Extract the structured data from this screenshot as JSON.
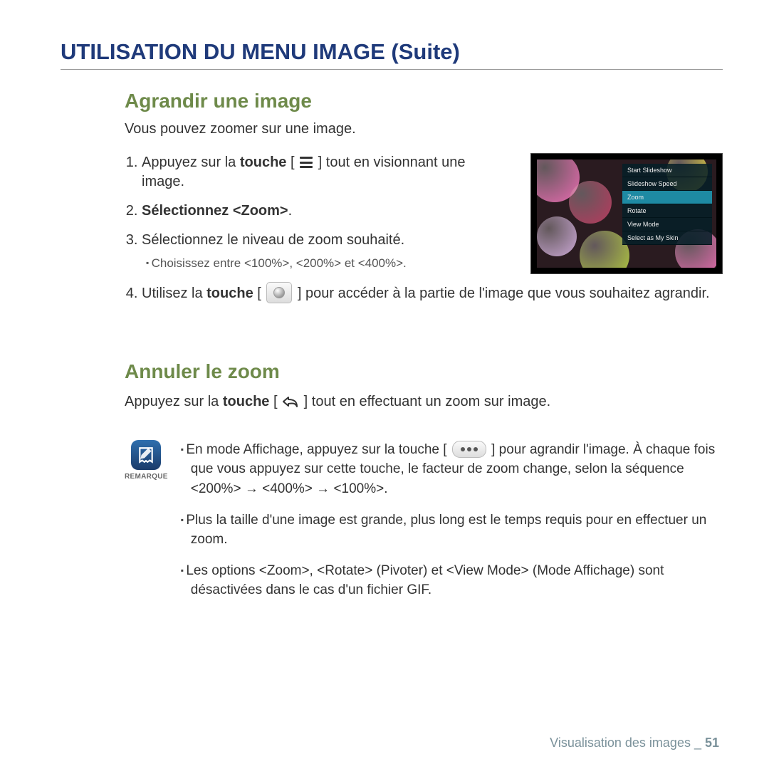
{
  "page_title": "UTILISATION DU MENU IMAGE (Suite)",
  "section1": {
    "title": "Agrandir une image",
    "intro": "Vous pouvez zoomer sur une image.",
    "steps": {
      "s1a": "Appuyez sur la ",
      "s1b": "touche",
      "s1c": " tout en visionnant une image.",
      "s2a": "Sélectionnez ",
      "s2b": "<Zoom>",
      "s2c": ".",
      "s3": "Sélectionnez le niveau de zoom souhaité.",
      "s3sub": "Choisissez entre <100%>, <200%> et <400%>.",
      "s4a": "Utilisez la ",
      "s4b": "touche",
      "s4c": " pour accéder à la partie de l'image que vous souhaitez agrandir."
    }
  },
  "device_menu": {
    "items": [
      "Start Slideshow",
      "Slideshow Speed",
      "Zoom",
      "Rotate",
      "View Mode",
      "Select as My Skin"
    ],
    "selected_index": 2
  },
  "section2": {
    "title": "Annuler le zoom",
    "line_a": "Appuyez sur la ",
    "line_b": "touche",
    "line_c": " tout en effectuant un zoom sur image."
  },
  "remark": {
    "label": "REMARQUE",
    "n1a": "En mode Affichage, appuyez sur la touche [ ",
    "n1b": " ] pour agrandir l'image. À chaque fois que vous appuyez sur cette touche, le facteur de zoom change, selon la séquence <200%> → <400%> → <100%>.",
    "n2": "Plus la taille d'une image est grande, plus long est le temps requis pour en effectuer un zoom.",
    "n3": "Les options <Zoom>, <Rotate> (Pivoter) et <View Mode> (Mode Affichage) sont désactivées dans le cas d'un fichier GIF."
  },
  "footer": {
    "section": "Visualisation des images",
    "sep": " _ ",
    "page": "51"
  }
}
